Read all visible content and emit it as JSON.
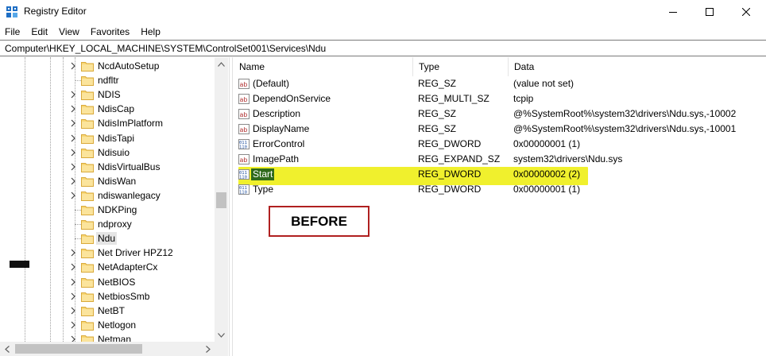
{
  "window": {
    "title": "Registry Editor",
    "icons": {
      "app": "registry-icon",
      "minimize": "minimize-icon",
      "maximize": "maximize-icon",
      "close": "close-icon"
    }
  },
  "menu": [
    {
      "label": "File"
    },
    {
      "label": "Edit"
    },
    {
      "label": "View"
    },
    {
      "label": "Favorites"
    },
    {
      "label": "Help"
    }
  ],
  "address": "Computer\\HKEY_LOCAL_MACHINE\\SYSTEM\\ControlSet001\\Services\\Ndu",
  "tree": {
    "items": [
      {
        "label": "NcdAutoSetup",
        "expandable": true
      },
      {
        "label": "ndfltr",
        "expandable": false
      },
      {
        "label": "NDIS",
        "expandable": true
      },
      {
        "label": "NdisCap",
        "expandable": true
      },
      {
        "label": "NdisImPlatform",
        "expandable": true
      },
      {
        "label": "NdisTapi",
        "expandable": true
      },
      {
        "label": "Ndisuio",
        "expandable": true
      },
      {
        "label": "NdisVirtualBus",
        "expandable": true
      },
      {
        "label": "NdisWan",
        "expandable": true
      },
      {
        "label": "ndiswanlegacy",
        "expandable": true
      },
      {
        "label": "NDKPing",
        "expandable": false
      },
      {
        "label": "ndproxy",
        "expandable": false
      },
      {
        "label": "Ndu",
        "expandable": false,
        "selected": true
      },
      {
        "label": "Net Driver HPZ12",
        "expandable": true
      },
      {
        "label": "NetAdapterCx",
        "expandable": true
      },
      {
        "label": "NetBIOS",
        "expandable": true
      },
      {
        "label": "NetbiosSmb",
        "expandable": true
      },
      {
        "label": "NetBT",
        "expandable": true
      },
      {
        "label": "Netlogon",
        "expandable": true
      },
      {
        "label": "Netman",
        "expandable": true
      }
    ]
  },
  "list": {
    "columns": {
      "name": "Name",
      "type": "Type",
      "data": "Data"
    },
    "rows": [
      {
        "name": "(Default)",
        "type": "REG_SZ",
        "data": "(value not set)",
        "icon": "string-value-icon"
      },
      {
        "name": "DependOnService",
        "type": "REG_MULTI_SZ",
        "data": "tcpip",
        "icon": "string-value-icon"
      },
      {
        "name": "Description",
        "type": "REG_SZ",
        "data": "@%SystemRoot%\\system32\\drivers\\Ndu.sys,-10002",
        "icon": "string-value-icon"
      },
      {
        "name": "DisplayName",
        "type": "REG_SZ",
        "data": "@%SystemRoot%\\system32\\drivers\\Ndu.sys,-10001",
        "icon": "string-value-icon"
      },
      {
        "name": "ErrorControl",
        "type": "REG_DWORD",
        "data": "0x00000001 (1)",
        "icon": "binary-value-icon"
      },
      {
        "name": "ImagePath",
        "type": "REG_EXPAND_SZ",
        "data": "system32\\drivers\\Ndu.sys",
        "icon": "string-value-icon"
      },
      {
        "name": "Start",
        "type": "REG_DWORD",
        "data": "0x00000002 (2)",
        "icon": "binary-value-icon",
        "highlighted": true
      },
      {
        "name": "Type",
        "type": "REG_DWORD",
        "data": "0x00000001 (1)",
        "icon": "binary-value-icon"
      }
    ]
  },
  "annotation": {
    "label": "BEFORE"
  },
  "colors": {
    "highlight": "#f0f02d",
    "selection": "#2f6a1b",
    "annotation_border": "#b02020",
    "folder": "#f8d775"
  }
}
